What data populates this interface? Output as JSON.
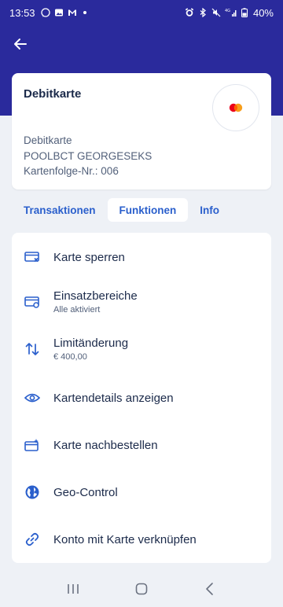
{
  "status_bar": {
    "time": "13:53",
    "battery": "40%",
    "network": "4G"
  },
  "header": {
    "back_icon": "arrow-left-icon"
  },
  "card": {
    "title": "Debitkarte",
    "type": "Debitkarte",
    "holder": "POOLBCT GEORGESEKS",
    "sequence": "Kartenfolge-Nr.: 006",
    "logo": "mastercard-logo"
  },
  "tabs": [
    {
      "label": "Transaktionen",
      "active": false
    },
    {
      "label": "Funktionen",
      "active": true
    },
    {
      "label": "Info",
      "active": false
    }
  ],
  "menu": [
    {
      "label": "Karte sperren",
      "sub": "",
      "icon": "card-block-icon"
    },
    {
      "label": "Einsatzbereiche",
      "sub": "Alle aktiviert",
      "icon": "card-settings-icon"
    },
    {
      "label": "Limitänderung",
      "sub": "€ 400,00",
      "icon": "arrows-up-down-icon"
    },
    {
      "label": "Kartendetails anzeigen",
      "sub": "",
      "icon": "eye-icon"
    },
    {
      "label": "Karte nachbestellen",
      "sub": "",
      "icon": "card-sparkle-icon"
    },
    {
      "label": "Geo-Control",
      "sub": "",
      "icon": "globe-icon"
    },
    {
      "label": "Konto mit Karte verknüpfen",
      "sub": "",
      "icon": "link-icon"
    }
  ],
  "colors": {
    "header_bg": "#2a2a9c",
    "accent": "#2a5fcc",
    "text_dark": "#1b2a4a",
    "page_bg": "#eef1f6"
  }
}
